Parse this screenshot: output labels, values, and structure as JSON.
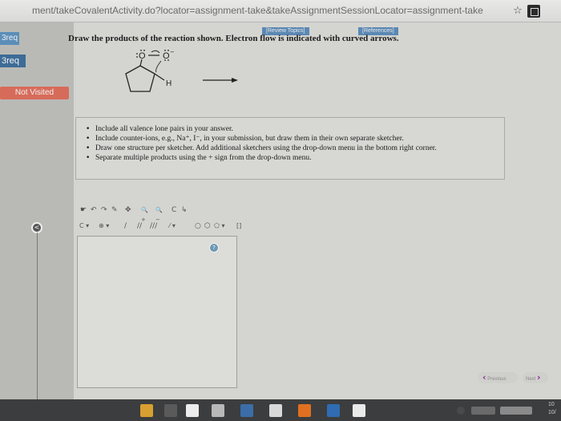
{
  "browser": {
    "url": "ment/takeCovalentActivity.do?locator=assignment-take&takeAssignmentSessionLocator=assignment-take"
  },
  "sidebar": {
    "items": [
      {
        "label": "3req"
      },
      {
        "label": "3req"
      },
      {
        "label": "Not Visited"
      }
    ]
  },
  "header": {
    "review_topics": "[Review Topics]",
    "references": "[References]"
  },
  "question": {
    "prompt": "Draw the products of the reaction shown. Electron flow is indicated with curved arrows.",
    "molecule": {
      "atom_o1": "O",
      "atom_o2": "O",
      "charge": "−",
      "atom_h": "H"
    }
  },
  "instructions": [
    "Include all valence lone pairs in your answer.",
    "Include counter-ions, e.g., Na⁺, I⁻, in your submission, but draw them in their own separate sketcher.",
    "Draw one structure per sketcher. Add additional sketchers using the drop-down menu in the bottom right corner.",
    "Separate multiple products using the + sign from the drop-down menu."
  ],
  "sketcher": {
    "toolbar_row1": [
      "☛",
      "↶",
      "↷",
      "✎",
      "✥",
      "🔍+",
      "🔍−",
      "C",
      "↳"
    ],
    "toolbar_row2": [
      "C ▾",
      "⊕ ▾",
      "/",
      "//",
      "///",
      "⁄ ▾",
      "○",
      "⬡",
      "⬠ ▾",
      "[]"
    ],
    "help": "?"
  },
  "pager": {
    "previous": "Previous",
    "next": "Next"
  },
  "taskbar": {
    "clock": "10",
    "date": "10/"
  },
  "colors": {
    "sidebar_active": "#3d6c96",
    "not_visited": "#d76b5a",
    "link_bg": "#5b88b3",
    "pager_chevron": "#8a2b8a"
  }
}
